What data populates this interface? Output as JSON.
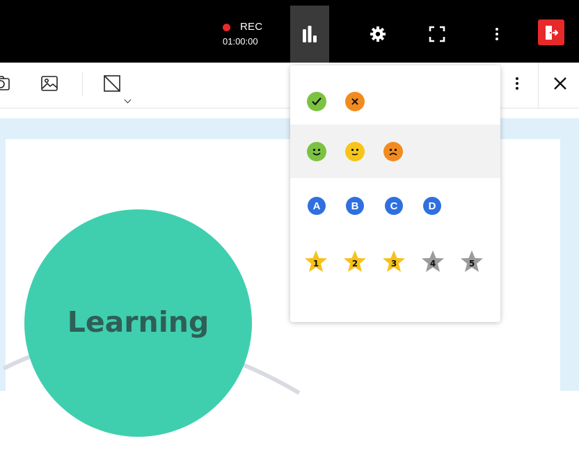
{
  "recording": {
    "label": "REC",
    "timer": "01:00:00"
  },
  "topbar": {
    "icons": [
      "poll-chart-icon",
      "gear-icon",
      "fullscreen-icon",
      "kebab-menu-icon",
      "exit-door-icon"
    ],
    "active_item": "poll-chart-icon",
    "exit_color": "#e8292a",
    "active_background": "#3a3a3a"
  },
  "toolbar": {
    "icons": [
      "camera-icon",
      "image-icon",
      "shape-icon",
      "kebab-menu-icon",
      "close-icon"
    ]
  },
  "canvas": {
    "node_label": "Learning",
    "node_color": "#3fcfaf",
    "background_color": "#dff0fb"
  },
  "poll_menu": {
    "rows": [
      {
        "name": "yes-no",
        "options": [
          "check-icon",
          "cross-icon"
        ]
      },
      {
        "name": "smileys",
        "highlighted": true,
        "options": [
          "smile-icon",
          "neutral-face-icon",
          "sad-face-icon"
        ]
      },
      {
        "name": "abcd",
        "options": [
          "A",
          "B",
          "C",
          "D"
        ]
      },
      {
        "name": "star-rating",
        "options": [
          "1",
          "2",
          "3",
          "4",
          "5"
        ],
        "filled_stars": 3
      }
    ],
    "colors": {
      "green": "#7cc242",
      "orange": "#f28b1f",
      "yellow": "#f7c51a",
      "blue": "#2f6fe0",
      "gold": "#f6c21a",
      "grey": "#9b9b9b"
    }
  }
}
